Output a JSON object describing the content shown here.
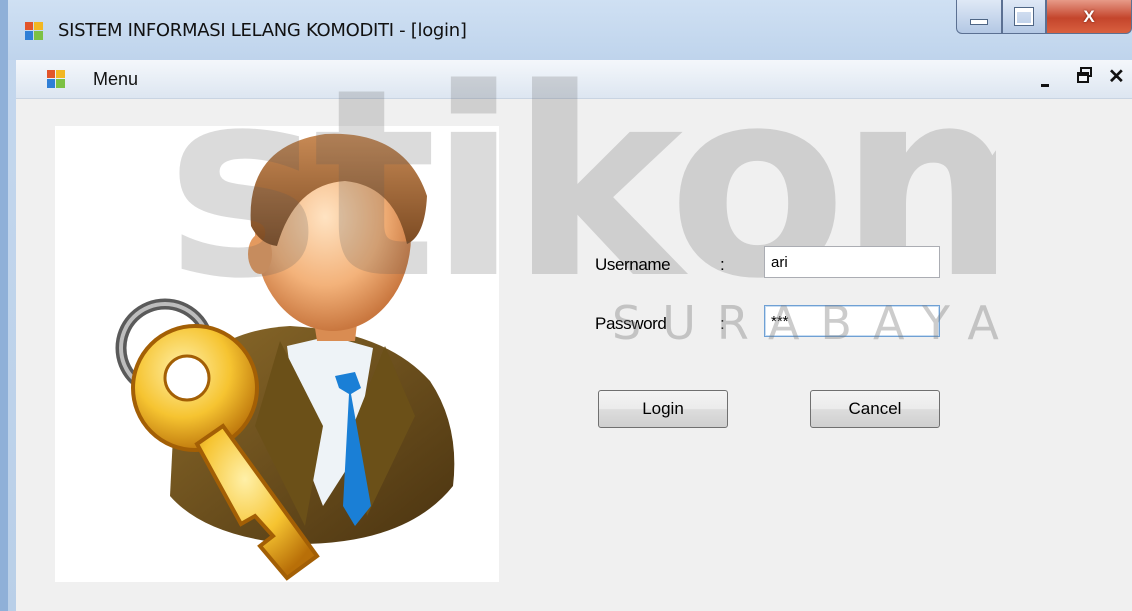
{
  "window": {
    "title": "SISTEM INFORMASI LELANG KOMODITI - [login]",
    "minimize_glyph": "–",
    "maximize_glyph": "□",
    "close_glyph": "X",
    "icon": "windows-form-icon"
  },
  "menubar": {
    "menu_label": "Menu",
    "mdi_minimize": "_",
    "mdi_restore": "Θ",
    "mdi_close": "✕"
  },
  "watermark": {
    "brand": "stikom",
    "sub": "SURABAYA"
  },
  "form": {
    "username_label": "Username",
    "password_label": "Password",
    "colon": ":",
    "username_value": "ari",
    "password_value": "***",
    "login_label": "Login",
    "cancel_label": "Cancel"
  },
  "illustration": {
    "icon": "user-with-key-icon"
  },
  "colors": {
    "close_button": "#c4452c",
    "titlebar": "#bfd4ec",
    "client_background": "#f0f0f0"
  }
}
